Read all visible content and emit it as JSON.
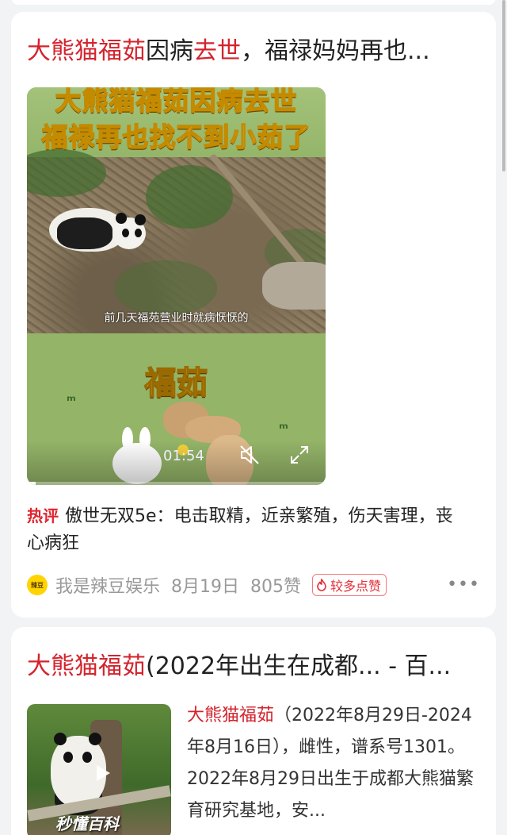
{
  "results": [
    {
      "title_parts": [
        {
          "text": "大熊猫福茹",
          "highlight": true
        },
        {
          "text": "因病",
          "highlight": false
        },
        {
          "text": "去世",
          "highlight": true
        },
        {
          "text": "，福禄妈妈再也...",
          "highlight": false
        }
      ],
      "video": {
        "headline_line1": "大熊猫福茹因病去世",
        "headline_line2": "福禄再也找不到小茹了",
        "subtitle": "前几天福苑营业时就病恹恹的",
        "name_caption": "福茹",
        "duration": "01:54",
        "progress": 0.03
      },
      "hot_comment": {
        "tag": "热评",
        "author": "傲世无双5e",
        "text": "电击取精，近亲繁殖，伤天害理，丧心病狂"
      },
      "meta": {
        "source_logo_text": "辣豆",
        "source": "我是辣豆娱乐",
        "date": "8月19日",
        "likes": "805赞",
        "badge": "较多点赞"
      }
    },
    {
      "title_parts": [
        {
          "text": "大熊猫福茹",
          "highlight": true
        },
        {
          "text": "(2022年出生在成都... - 百...",
          "highlight": false
        }
      ],
      "thumb_brand": "秒懂百科",
      "desc_highlight": "大熊猫福茹",
      "desc_text": "（2022年8月29日-2024年8月16日），雌性，谱系号1301。2022年8月29日出生于成都大熊猫繁育研究基地，安..."
    }
  ]
}
